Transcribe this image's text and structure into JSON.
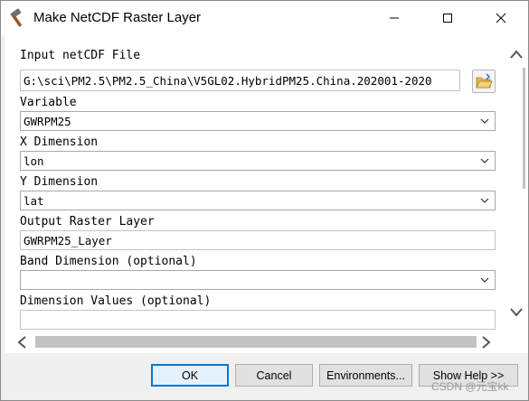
{
  "window": {
    "title": "Make NetCDF Raster Layer"
  },
  "fields": {
    "input_netcdf": {
      "label": "Input netCDF File",
      "value": "G:\\sci\\PM2.5\\PM2.5_China\\V5GL02.HybridPM25.China.202001-2020"
    },
    "variable": {
      "label": "Variable",
      "value": "GWRPM25"
    },
    "x_dimension": {
      "label": "X Dimension",
      "value": "lon"
    },
    "y_dimension": {
      "label": "Y Dimension",
      "value": "lat"
    },
    "output_raster": {
      "label": "Output Raster Layer",
      "value": "GWRPM25_Layer"
    },
    "band_dimension": {
      "label": "Band Dimension (optional)",
      "value": ""
    },
    "dimension_values": {
      "label": "Dimension Values (optional)",
      "value": ""
    }
  },
  "buttons": {
    "ok": "OK",
    "cancel": "Cancel",
    "environments": "Environments...",
    "show_help": "Show Help >>"
  },
  "watermark": "CSDN @元宝kk",
  "icons": {
    "app": "hammer-icon",
    "browse": "folder-open-icon"
  },
  "colors": {
    "focus_border": "#0078d7",
    "background": "#f0f0f0"
  }
}
